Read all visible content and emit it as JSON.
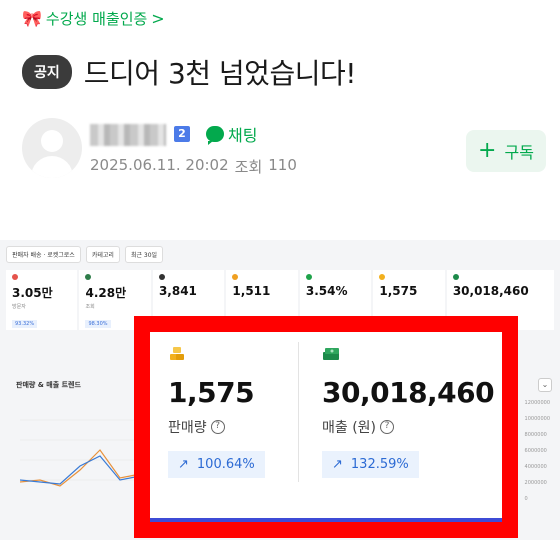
{
  "breadcrumb": {
    "label": "수강생 매출인증",
    "chevron": ">"
  },
  "post": {
    "badge": "공지",
    "title": "드디어 3천 넘었습니다!"
  },
  "author": {
    "level": "2",
    "chat_label": "채팅",
    "date": "2025.06.11. 20:02",
    "views_label": "조회",
    "views": "110"
  },
  "subscribe": {
    "icon": "+",
    "label": "구독"
  },
  "dashboard": {
    "toolbar": [
      "판매자 배송 · 로켓그로스",
      "카테고리",
      "최근 30일"
    ],
    "mini_stats": [
      {
        "value": "3.05만",
        "label": "방문자",
        "change": "93.32%"
      },
      {
        "value": "4.28만",
        "label": "조회",
        "change": "98.30%"
      },
      {
        "value": "3,841",
        "label": "",
        "change": ""
      },
      {
        "value": "1,511",
        "label": "",
        "change": ""
      },
      {
        "value": "3.54%",
        "label": "",
        "change": ""
      },
      {
        "value": "1,575",
        "label": "",
        "change": ""
      },
      {
        "value": "30,018,460",
        "label": "",
        "change": ""
      }
    ],
    "trend_title": "판매량 & 매출 트렌드",
    "right_axis": [
      "12000000",
      "10000000",
      "8000000",
      "6000000",
      "4000000",
      "2000000",
      "0"
    ]
  },
  "highlight": {
    "sales": {
      "value": "1,575",
      "label": "판매량",
      "change": "100.64%"
    },
    "revenue": {
      "value": "30,018,460",
      "label": "매출 (원)",
      "change": "132.59%"
    }
  },
  "colors": {
    "accent": "#03a94d",
    "highlight_border": "#ff0000",
    "change_blue": "#2d6bd4"
  }
}
